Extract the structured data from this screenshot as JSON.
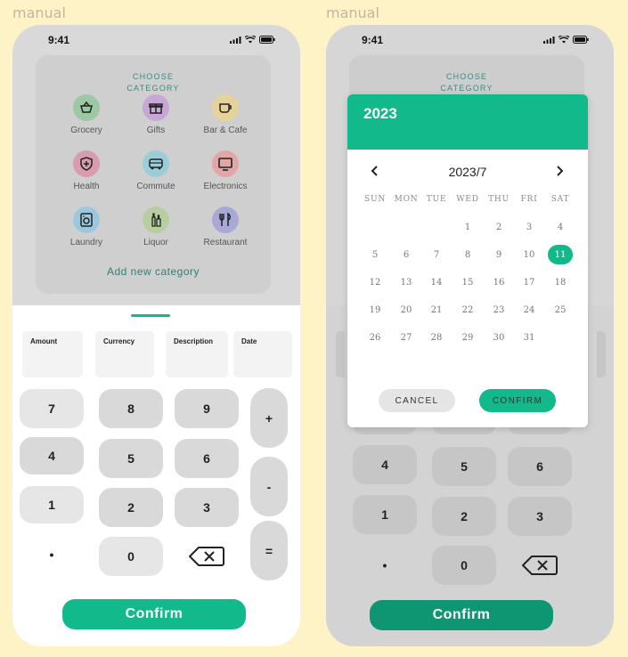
{
  "labels": {
    "left": "manual",
    "right": "manual"
  },
  "status": {
    "time": "9:41"
  },
  "category_panel": {
    "title_line1": "CHOOSE",
    "title_line2": "CATEGORY",
    "items": [
      {
        "label": "Grocery",
        "icon": "basket-icon",
        "color": "#9BC9A3"
      },
      {
        "label": "Gifts",
        "icon": "gift-icon",
        "color": "#C9A6D6"
      },
      {
        "label": "Bar & Cafe",
        "icon": "coffee-cup-icon",
        "color": "#E5D39A"
      },
      {
        "label": "Health",
        "icon": "shield-plus-icon",
        "color": "#D99BAE"
      },
      {
        "label": "Commute",
        "icon": "bus-icon",
        "color": "#9ACDD8"
      },
      {
        "label": "Electronics",
        "icon": "tv-icon",
        "color": "#E2A6A6"
      },
      {
        "label": "Laundry",
        "icon": "washing-machine-icon",
        "color": "#9CC8DE"
      },
      {
        "label": "Liquor",
        "icon": "bottles-icon",
        "color": "#B7CF9E"
      },
      {
        "label": "Restaurant",
        "icon": "fork-knife-icon",
        "color": "#A8A9D6"
      }
    ],
    "add_label": "Add new category"
  },
  "fields": [
    {
      "label": "Amount"
    },
    {
      "label": "Currency"
    },
    {
      "label": "Description"
    },
    {
      "label": "Date"
    }
  ],
  "keypad": {
    "digits": [
      "7",
      "8",
      "9",
      "4",
      "5",
      "6",
      "1",
      "2",
      "3",
      "•",
      "0"
    ],
    "ops": [
      "+",
      "-",
      "="
    ]
  },
  "confirm_label": "Confirm",
  "date_dialog": {
    "year": "2023",
    "month_label": "2023/7",
    "weekdays": [
      "SUN",
      "MON",
      "TUE",
      "WED",
      "THU",
      "FRI",
      "SAT"
    ],
    "days": [
      "1",
      "2",
      "3",
      "4",
      "5",
      "6",
      "7",
      "8",
      "9",
      "10",
      "11",
      "12",
      "13",
      "14",
      "15",
      "16",
      "17",
      "18",
      "19",
      "20",
      "21",
      "22",
      "23",
      "24",
      "25",
      "26",
      "27",
      "28",
      "29",
      "30",
      "31"
    ],
    "first_weekday_index": 3,
    "selected_day": "11",
    "cancel_label": "CANCEL",
    "confirm_label": "CONFIRM"
  },
  "colors": {
    "accent": "#12B98A",
    "background": "#FEF3C7"
  }
}
